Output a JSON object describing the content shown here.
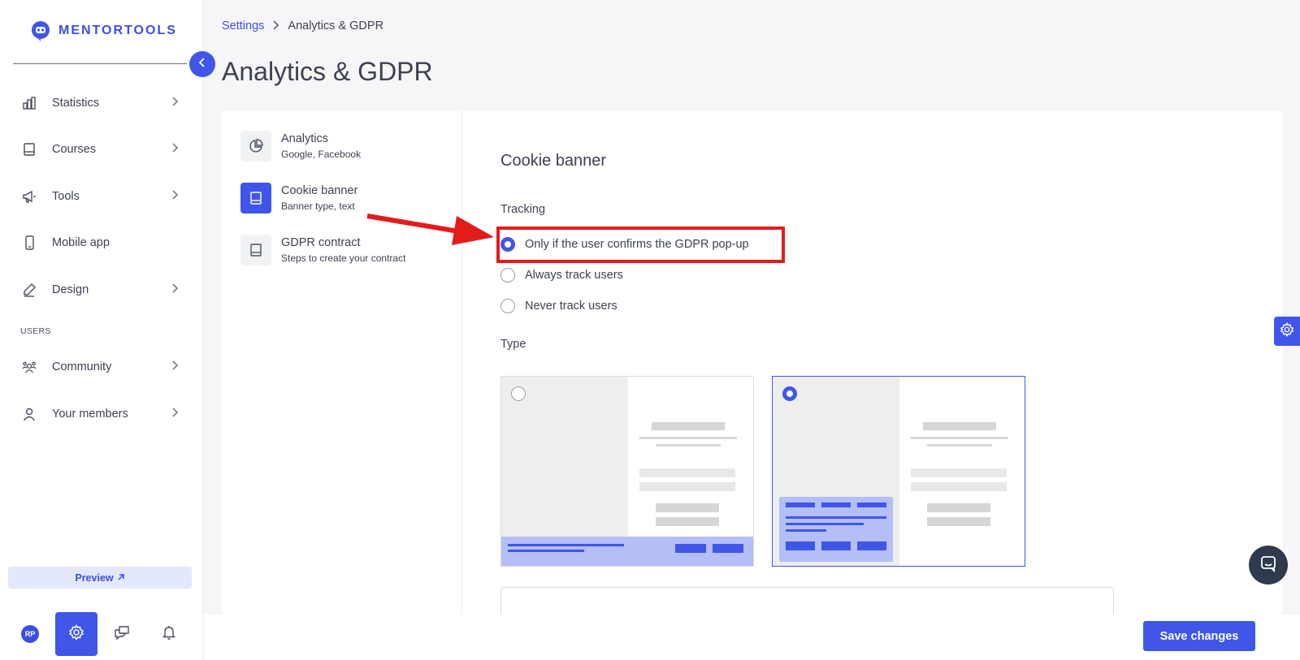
{
  "brand": {
    "name": "MENTORTOOLS"
  },
  "sidebar": {
    "items": [
      {
        "label": "Statistics",
        "icon": "bar-chart-icon"
      },
      {
        "label": "Courses",
        "icon": "book-icon"
      },
      {
        "label": "Tools",
        "icon": "megaphone-icon"
      },
      {
        "label": "Mobile app",
        "icon": "mobile-icon"
      },
      {
        "label": "Design",
        "icon": "pencil-icon"
      }
    ],
    "users_section": "USERS",
    "user_items": [
      {
        "label": "Community",
        "icon": "community-icon"
      },
      {
        "label": "Your members",
        "icon": "user-icon"
      }
    ],
    "preview_label": "Preview",
    "avatar_initials": "RP"
  },
  "breadcrumb": {
    "root": "Settings",
    "current": "Analytics & GDPR"
  },
  "page_title": "Analytics & GDPR",
  "subnav": [
    {
      "title": "Analytics",
      "desc": "Google, Facebook",
      "active": false
    },
    {
      "title": "Cookie banner",
      "desc": "Banner type, text",
      "active": true
    },
    {
      "title": "GDPR contract",
      "desc": "Steps to create your contract",
      "active": false
    }
  ],
  "content": {
    "section_title": "Cookie banner",
    "tracking_label": "Tracking",
    "tracking_options": [
      {
        "label": "Only if the user confirms the GDPR pop-up",
        "checked": true
      },
      {
        "label": "Always track users",
        "checked": false
      },
      {
        "label": "Never track users",
        "checked": false
      }
    ],
    "type_label": "Type",
    "type_options": [
      {
        "name": "bottom-bar",
        "selected": false
      },
      {
        "name": "corner-box",
        "selected": true
      }
    ]
  },
  "save_label": "Save changes",
  "colors": {
    "accent": "#3f56e8",
    "highlight": "#e31b1b",
    "banner_preview": "#b4bef7"
  }
}
